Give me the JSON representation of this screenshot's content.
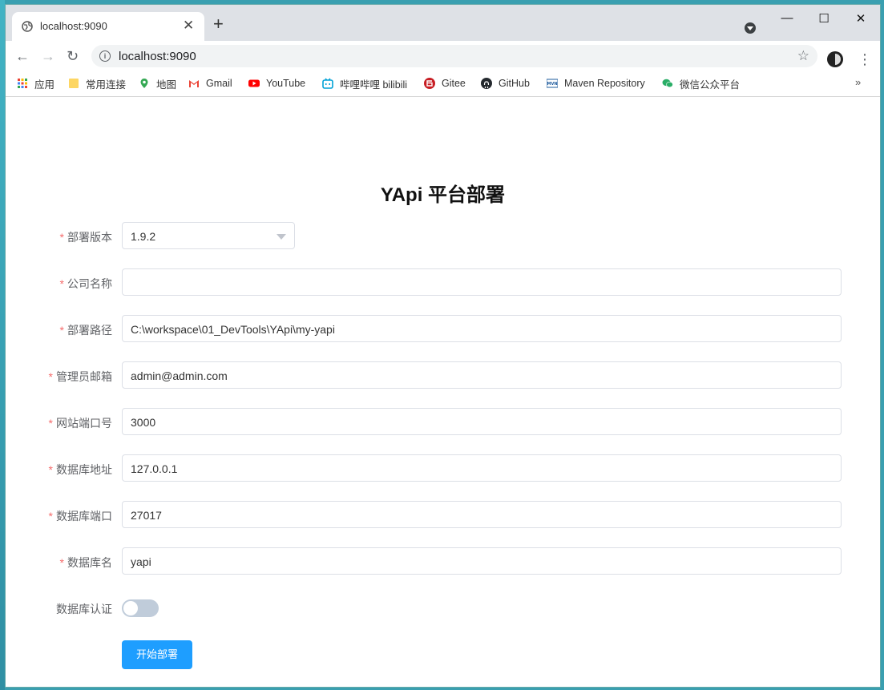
{
  "browser": {
    "tab_title": "localhost:9090",
    "url": "localhost:9090"
  },
  "bookmarks": [
    {
      "label": "应用",
      "icon": "apps-grid-icon"
    },
    {
      "label": "常用连接",
      "icon": "folder-icon"
    },
    {
      "label": "地图",
      "icon": "maps-pin-icon"
    },
    {
      "label": "Gmail",
      "icon": "gmail-icon"
    },
    {
      "label": "YouTube",
      "icon": "youtube-icon"
    },
    {
      "label": "哔哩哔哩 bilibili",
      "icon": "bilibili-icon"
    },
    {
      "label": "Gitee",
      "icon": "gitee-icon"
    },
    {
      "label": "GitHub",
      "icon": "github-icon"
    },
    {
      "label": "Maven Repository",
      "icon": "maven-icon"
    },
    {
      "label": "微信公众平台",
      "icon": "wechat-icon"
    }
  ],
  "form": {
    "title": "YApi 平台部署",
    "version": {
      "label": "部署版本",
      "value": "1.9.2",
      "required": true
    },
    "company": {
      "label": "公司名称",
      "value": "",
      "required": true
    },
    "path": {
      "label": "部署路径",
      "value": "C:\\workspace\\01_DevTools\\YApi\\my-yapi",
      "required": true
    },
    "admin_email": {
      "label": "管理员邮箱",
      "value": "admin@admin.com",
      "required": true
    },
    "port": {
      "label": "网站端口号",
      "value": "3000",
      "required": true
    },
    "db_host": {
      "label": "数据库地址",
      "value": "127.0.0.1",
      "required": true
    },
    "db_port": {
      "label": "数据库端口",
      "value": "27017",
      "required": true
    },
    "db_name": {
      "label": "数据库名",
      "value": "yapi",
      "required": true
    },
    "db_auth": {
      "label": "数据库认证",
      "enabled": false
    },
    "submit_label": "开始部署",
    "required_mark": "*"
  },
  "colors": {
    "primary": "#1e9eff",
    "required": "#f56c6c",
    "switch_off": "#c0ccda"
  }
}
